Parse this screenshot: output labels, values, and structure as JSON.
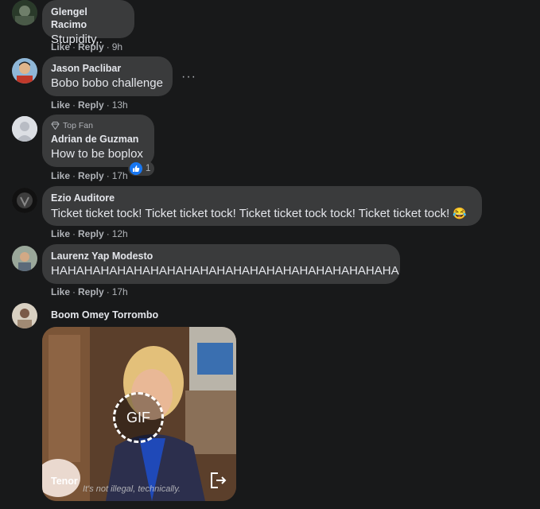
{
  "comments": [
    {
      "author": "Glengel Racimo",
      "text": "Stupidity..",
      "time": "9h"
    },
    {
      "author": "Jason Paclibar",
      "text": "Bobo bobo challenge",
      "time": "13h"
    },
    {
      "author": "Adrian de Guzman",
      "badge": "Top Fan",
      "text": "How to be boplox",
      "time": "17h",
      "reaction_count": "1"
    },
    {
      "author": "Ezio Auditore",
      "text": "Ticket ticket tock! Ticket ticket tock! Ticket ticket tock tock! Ticket ticket tock!",
      "emoji": "😂",
      "time": "12h"
    },
    {
      "author": "Laurenz Yap Modesto",
      "text": "HAHAHAHAHAHAHAHAHAHAHAHAHAHAHAHAHAHAHAHAHA",
      "time": "17h"
    },
    {
      "author": "Boom Omey Torrombo"
    }
  ],
  "actions": {
    "like": "Like",
    "reply": "Reply",
    "sep": "·"
  },
  "more": "···",
  "gif": {
    "label": "GIF",
    "provider": "Tenor",
    "caption": "It's not illegal, technically."
  },
  "colors": {
    "bg": "#18191a",
    "bubble": "#3a3b3c",
    "text": "#e4e6eb",
    "meta": "#b0b3b8",
    "like": "#1877f2"
  }
}
